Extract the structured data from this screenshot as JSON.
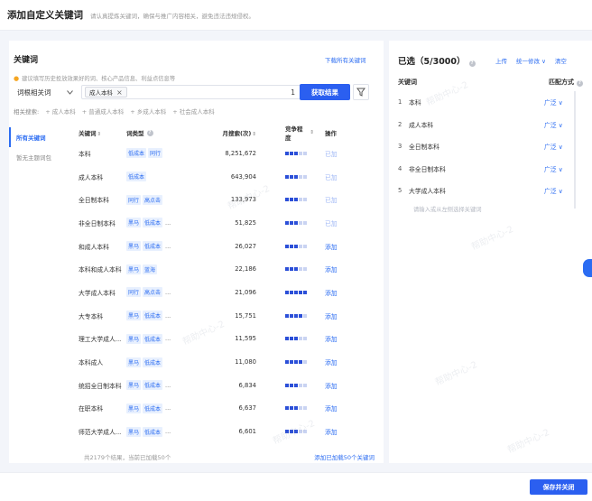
{
  "header": {
    "title": "添加自定义关键词",
    "subtitle": "请认真提炼关键词，确保与推广内容相关，避免违法违规侵权。"
  },
  "left": {
    "title": "关键词",
    "download_link": "下载所有关键词",
    "tip": "建议填写历史投放效果好的词、核心产品信息、利益点信息等",
    "selector_value": "词根相关词",
    "input_tag": "成人本科",
    "input_count": "1",
    "search_button": "获取结果",
    "related_label": "相关搜索:",
    "related_items": [
      "+ 成人本科",
      "+ 普通成人本科",
      "+ 乡成人本科",
      "+ 社会成人本科"
    ],
    "tabs": [
      "所有关键词",
      "暂无主题词包"
    ],
    "columns": {
      "keyword": "关键词",
      "type": "词类型",
      "volume": "月搜索(次)",
      "competition": "竞争程度",
      "op": "操作"
    },
    "rows": [
      {
        "keyword": "本科",
        "tags": [
          "低成本",
          "同行"
        ],
        "more": "",
        "volume": "8,251,672",
        "comp": 3,
        "op": "已加"
      },
      {
        "keyword": "成人本科",
        "tags": [
          "低成本"
        ],
        "more": "",
        "volume": "643,904",
        "comp": 3,
        "op": "已加"
      },
      {
        "keyword": "全日制本科",
        "tags": [
          "同行",
          "高点击"
        ],
        "more": "",
        "volume": "133,973",
        "comp": 3,
        "op": "已加"
      },
      {
        "keyword": "非全日制本科",
        "tags": [
          "黑马",
          "低成本"
        ],
        "more": "...",
        "volume": "51,825",
        "comp": 3,
        "op": "已加"
      },
      {
        "keyword": "和成人本科",
        "tags": [
          "黑马",
          "低成本"
        ],
        "more": "...",
        "volume": "26,027",
        "comp": 3,
        "op": "添加"
      },
      {
        "keyword": "本科和成人本科",
        "tags": [
          "黑马",
          "蓝海"
        ],
        "more": "",
        "volume": "22,186",
        "comp": 3,
        "op": "添加"
      },
      {
        "keyword": "大学成人本科",
        "tags": [
          "同行",
          "高点击"
        ],
        "more": "...",
        "volume": "21,096",
        "comp": 5,
        "op": "添加"
      },
      {
        "keyword": "大专本科",
        "tags": [
          "黑马",
          "低成本"
        ],
        "more": "...",
        "volume": "15,751",
        "comp": 4,
        "op": "添加"
      },
      {
        "keyword": "理工大学成人...",
        "tags": [
          "黑马",
          "低成本"
        ],
        "more": "...",
        "volume": "11,595",
        "comp": 3,
        "op": "添加"
      },
      {
        "keyword": "本科成人",
        "tags": [
          "黑马",
          "低成本"
        ],
        "more": "",
        "volume": "11,080",
        "comp": 4,
        "op": "添加"
      },
      {
        "keyword": "统招全日制本科",
        "tags": [
          "黑马",
          "低成本"
        ],
        "more": "...",
        "volume": "6,834",
        "comp": 3,
        "op": "添加"
      },
      {
        "keyword": "在职本科",
        "tags": [
          "黑马",
          "低成本"
        ],
        "more": "...",
        "volume": "6,637",
        "comp": 3,
        "op": "添加"
      },
      {
        "keyword": "师范大学成人...",
        "tags": [
          "黑马",
          "低成本"
        ],
        "more": "...",
        "volume": "6,601",
        "comp": 3,
        "op": "添加"
      }
    ],
    "footer_count": "共2179个结果，当前已加载50个",
    "footer_action": "添加已加载50个关键词"
  },
  "right": {
    "title": "已选（5/3000）",
    "upload": "上传",
    "bulk_edit": "统一修改",
    "clear": "清空",
    "col_keyword": "关键词",
    "col_match": "匹配方式",
    "items": [
      {
        "idx": "1",
        "keyword": "本科",
        "match": "广泛"
      },
      {
        "idx": "2",
        "keyword": "成人本科",
        "match": "广泛"
      },
      {
        "idx": "3",
        "keyword": "全日制本科",
        "match": "广泛"
      },
      {
        "idx": "4",
        "keyword": "非全日制本科",
        "match": "广泛"
      },
      {
        "idx": "5",
        "keyword": "大学成人本科",
        "match": "广泛"
      }
    ],
    "hint": "请输入或从左侧选择关键词"
  },
  "footer": {
    "save_button": "保存并关闭"
  },
  "watermark": "帮助中心-2"
}
